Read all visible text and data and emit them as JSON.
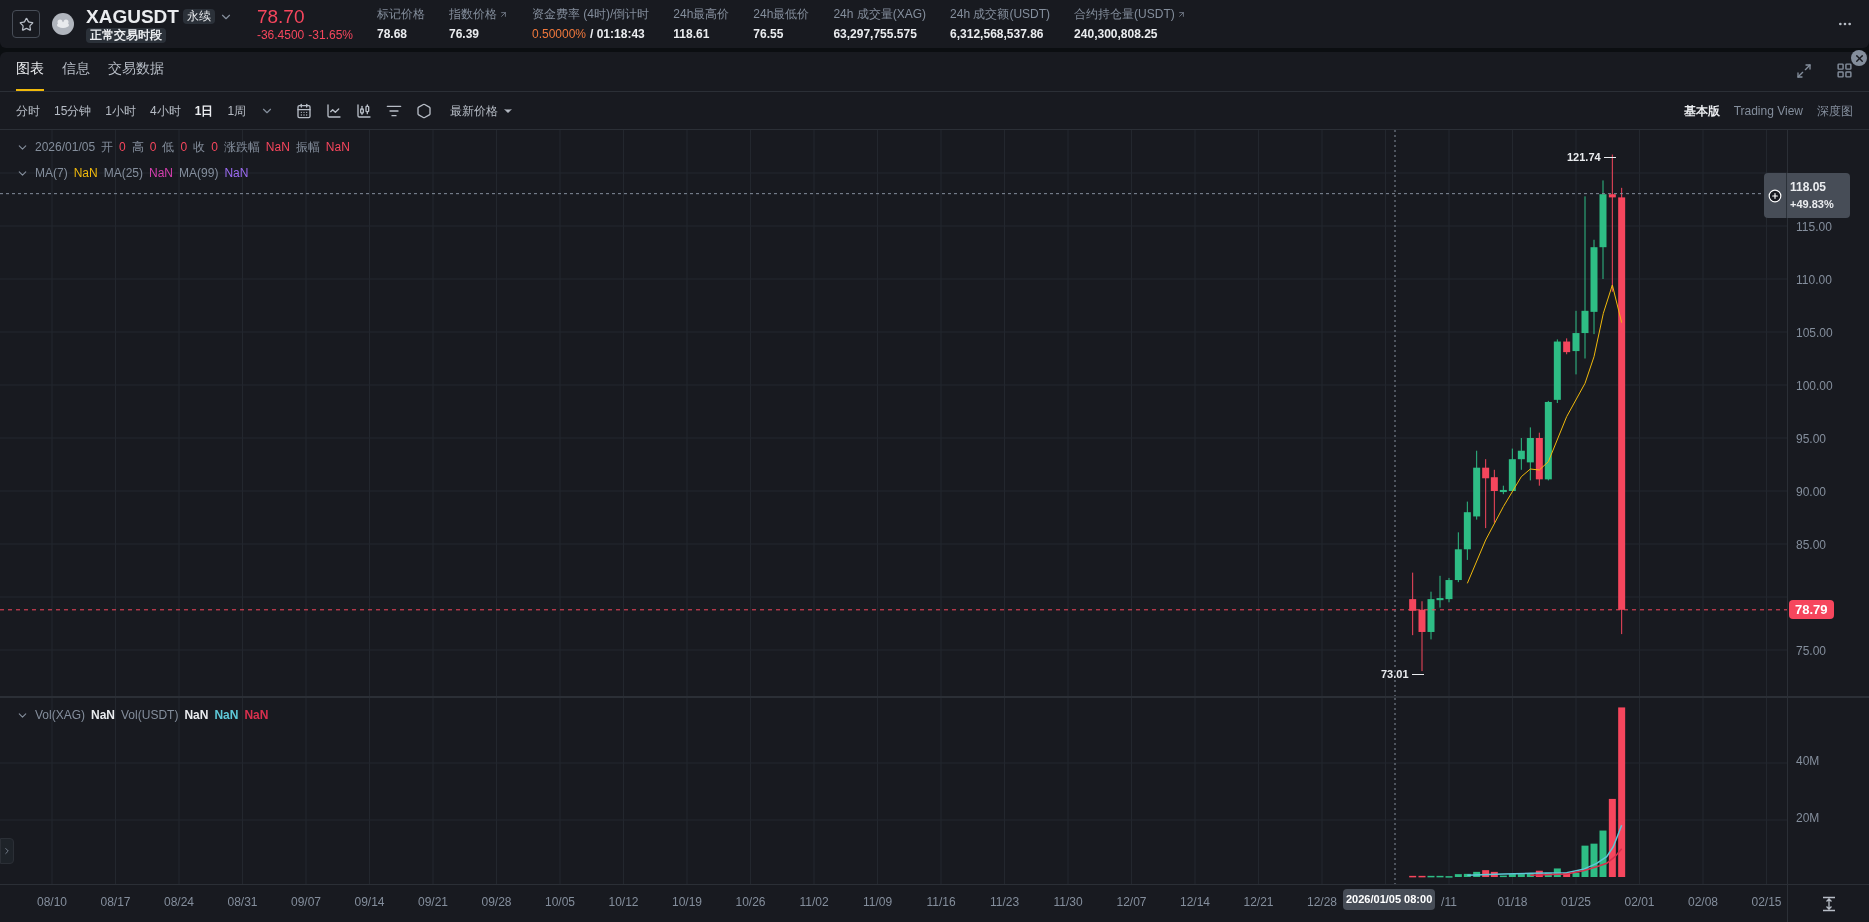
{
  "header": {
    "favorite": false,
    "symbol": "XAGUSDT",
    "contract_badge": "永续",
    "session_badge": "正常交易时段",
    "price": "78.70",
    "change": "-36.4500",
    "change_percent": "-31.65%",
    "stats": [
      {
        "label": "标记价格",
        "value": "78.68",
        "kind": "plain",
        "link": false
      },
      {
        "label": "指数价格",
        "value": "76.39",
        "kind": "plain",
        "link": true
      },
      {
        "label": "资金费率 (4时)/倒计时",
        "value": "0.50000%",
        "countdown": "/ 01:18:43",
        "kind": "funding",
        "link": false
      },
      {
        "label": "24h最高价",
        "value": "118.61",
        "kind": "plain",
        "link": false
      },
      {
        "label": "24h最低价",
        "value": "76.55",
        "kind": "plain",
        "link": false
      },
      {
        "label": "24h 成交量(XAG)",
        "value": "63,297,755.575",
        "kind": "plain",
        "link": false
      },
      {
        "label": "24h 成交额(USDT)",
        "value": "6,312,568,537.86",
        "kind": "plain",
        "link": false
      },
      {
        "label": "合约持仓量(USDT)",
        "value": "240,300,808.25",
        "kind": "plain",
        "link": true
      }
    ]
  },
  "tabs": [
    {
      "label": "图表",
      "selected": true
    },
    {
      "label": "信息",
      "selected": false
    },
    {
      "label": "交易数据",
      "selected": false
    }
  ],
  "intervals": [
    {
      "label": "分时",
      "selected": false
    },
    {
      "label": "15分钟",
      "selected": false
    },
    {
      "label": "1小时",
      "selected": false
    },
    {
      "label": "4小时",
      "selected": false
    },
    {
      "label": "1日",
      "selected": true
    },
    {
      "label": "1周",
      "selected": false
    }
  ],
  "price_type": "最新价格",
  "views": [
    {
      "label": "基本版",
      "selected": true
    },
    {
      "label": "Trading View",
      "selected": false
    },
    {
      "label": "深度图",
      "selected": false
    }
  ],
  "legend": {
    "date": "2026/01/05",
    "fields": [
      {
        "label": "开",
        "value": "0"
      },
      {
        "label": "高",
        "value": "0"
      },
      {
        "label": "低",
        "value": "0"
      },
      {
        "label": "收",
        "value": "0"
      },
      {
        "label": "涨跌幅",
        "value": "NaN"
      },
      {
        "label": "振幅",
        "value": "NaN"
      }
    ]
  },
  "ma_legend": [
    {
      "label": "MA(7)",
      "value": "NaN",
      "color": "#f0b90b"
    },
    {
      "label": "MA(25)",
      "value": "NaN",
      "color": "#d63fb0"
    },
    {
      "label": "MA(99)",
      "value": "NaN",
      "color": "#9b6bf2"
    }
  ],
  "price_axis": {
    "ticks": [
      "115.00",
      "110.00",
      "105.00",
      "100.00",
      "95.00",
      "90.00",
      "85.00",
      "75.00"
    ],
    "high_label": "121.74",
    "low_label": "73.01",
    "crosshair_price": "118.05",
    "crosshair_change": "+49.83%",
    "last_price": "78.79"
  },
  "volume_legend": [
    {
      "label": "Vol(XAG)",
      "value": "NaN",
      "color": "#eaecef"
    },
    {
      "label": "Vol(USDT)",
      "value": "NaN",
      "color": "#eaecef"
    },
    {
      "value": "NaN",
      "color": "#5ec8d8"
    },
    {
      "value": "NaN",
      "color": "#d9304e"
    }
  ],
  "volume_axis": {
    "ticks": [
      "40M",
      "20M"
    ]
  },
  "time_axis": {
    "labels": [
      "08/10",
      "08/17",
      "08/24",
      "08/31",
      "09/07",
      "09/14",
      "09/21",
      "09/28",
      "10/05",
      "10/12",
      "10/19",
      "10/26",
      "11/02",
      "11/09",
      "11/16",
      "11/23",
      "11/30",
      "12/07",
      "12/14",
      "12/21",
      "12/28",
      "/11",
      "01/18",
      "01/25",
      "02/01",
      "02/08",
      "02/15"
    ],
    "crosshair_time": "2026/01/05 08:00"
  }
}
